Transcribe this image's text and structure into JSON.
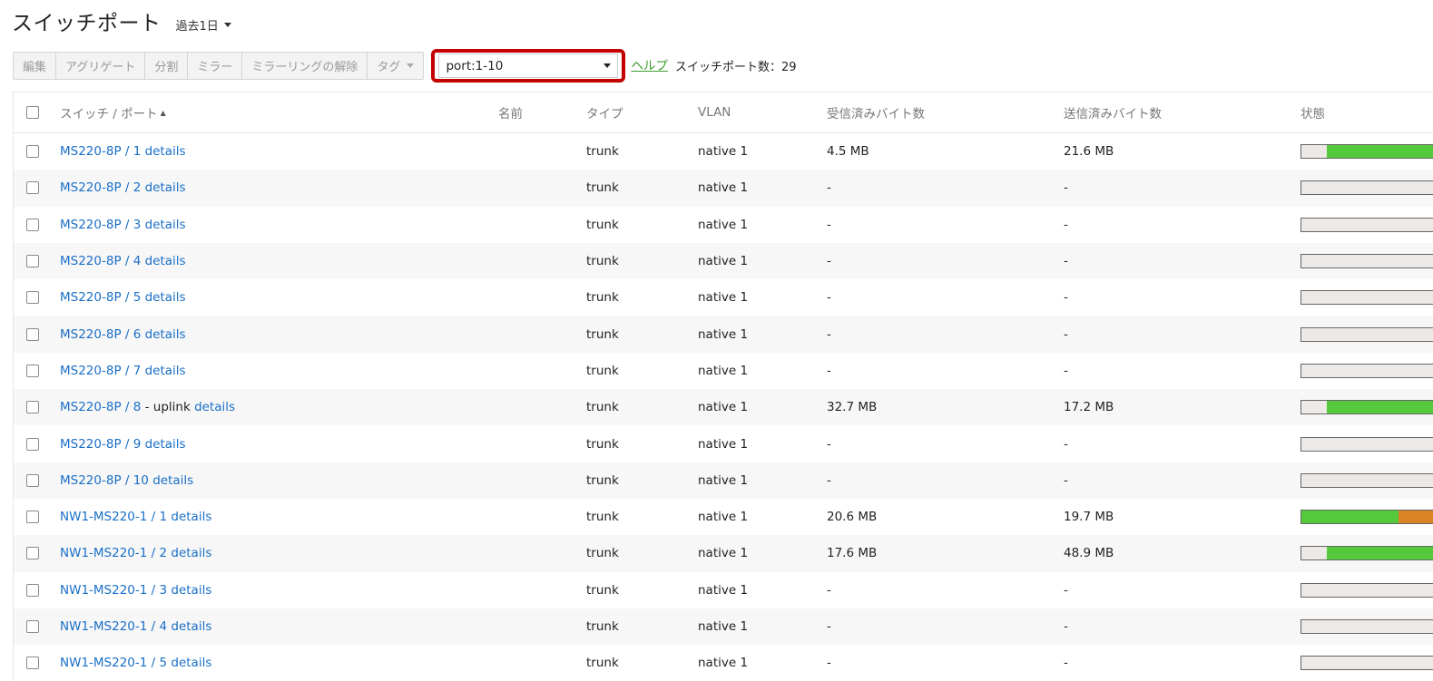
{
  "header": {
    "title": "スイッチポート",
    "timespan": "過去1日"
  },
  "toolbar": {
    "buttons": [
      "編集",
      "アグリゲート",
      "分割",
      "ミラー",
      "ミラーリングの解除",
      "タグ"
    ],
    "search_value": "port:1-10",
    "help_label": "ヘルプ",
    "count_text": "スイッチポート数：29"
  },
  "table": {
    "columns": [
      "スイッチ / ポート",
      "名前",
      "タイプ",
      "VLAN",
      "受信済みバイト数",
      "送信済みバイト数",
      "状態"
    ],
    "rows": [
      {
        "port": "MS220-8P / 1",
        "suffix": "",
        "details": "details",
        "type": "trunk",
        "vlan": "native 1",
        "rx": "4.5 MB",
        "tx": "21.6 MB"
      },
      {
        "port": "MS220-8P / 2",
        "suffix": "",
        "details": "details",
        "type": "trunk",
        "vlan": "native 1",
        "rx": "-",
        "tx": "-"
      },
      {
        "port": "MS220-8P / 3",
        "suffix": "",
        "details": "details",
        "type": "trunk",
        "vlan": "native 1",
        "rx": "-",
        "tx": "-"
      },
      {
        "port": "MS220-8P / 4",
        "suffix": "",
        "details": "details",
        "type": "trunk",
        "vlan": "native 1",
        "rx": "-",
        "tx": "-"
      },
      {
        "port": "MS220-8P / 5",
        "suffix": "",
        "details": "details",
        "type": "trunk",
        "vlan": "native 1",
        "rx": "-",
        "tx": "-"
      },
      {
        "port": "MS220-8P / 6",
        "suffix": "",
        "details": "details",
        "type": "trunk",
        "vlan": "native 1",
        "rx": "-",
        "tx": "-"
      },
      {
        "port": "MS220-8P / 7",
        "suffix": "",
        "details": "details",
        "type": "trunk",
        "vlan": "native 1",
        "rx": "-",
        "tx": "-"
      },
      {
        "port": "MS220-8P / 8",
        "suffix": " - uplink ",
        "details": "details",
        "type": "trunk",
        "vlan": "native 1",
        "rx": "32.7 MB",
        "tx": "17.2 MB"
      },
      {
        "port": "MS220-8P / 9",
        "suffix": "",
        "details": "details",
        "type": "trunk",
        "vlan": "native 1",
        "rx": "-",
        "tx": "-"
      },
      {
        "port": "MS220-8P / 10",
        "suffix": "",
        "details": "details",
        "type": "trunk",
        "vlan": "native 1",
        "rx": "-",
        "tx": "-"
      },
      {
        "port": "NW1-MS220-1 / 1",
        "suffix": "",
        "details": "details",
        "type": "trunk",
        "vlan": "native 1",
        "rx": "20.6 MB",
        "tx": "19.7 MB"
      },
      {
        "port": "NW1-MS220-1 / 2",
        "suffix": "",
        "details": "details",
        "type": "trunk",
        "vlan": "native 1",
        "rx": "17.6 MB",
        "tx": "48.9 MB"
      },
      {
        "port": "NW1-MS220-1 / 3",
        "suffix": "",
        "details": "details",
        "type": "trunk",
        "vlan": "native 1",
        "rx": "-",
        "tx": "-"
      },
      {
        "port": "NW1-MS220-1 / 4",
        "suffix": "",
        "details": "details",
        "type": "trunk",
        "vlan": "native 1",
        "rx": "-",
        "tx": "-"
      },
      {
        "port": "NW1-MS220-1 / 5",
        "suffix": "",
        "details": "details",
        "type": "trunk",
        "vlan": "native 1",
        "rx": "-",
        "tx": "-"
      }
    ],
    "status_bars": [
      [
        {
          "fraction": 0.19,
          "color": "#ede9e6"
        },
        {
          "fraction": 0.81,
          "color": "#54c93c"
        }
      ],
      [],
      [],
      [],
      [],
      [],
      [],
      [
        {
          "fraction": 0.19,
          "color": "#ede9e6"
        },
        {
          "fraction": 0.81,
          "color": "#54c93c"
        }
      ],
      [],
      [],
      [
        {
          "fraction": 0.72,
          "color": "#54c93c"
        },
        {
          "fraction": 0.28,
          "color": "#d98425"
        }
      ],
      [
        {
          "fraction": 0.19,
          "color": "#ede9e6"
        },
        {
          "fraction": 0.81,
          "color": "#54c93c"
        }
      ],
      [],
      [],
      []
    ]
  },
  "colors": {
    "link": "#1a6fc7",
    "help_link": "#3e9b2f",
    "highlight_border": "#c40000",
    "status_green": "#54c93c",
    "status_orange": "#d98425"
  }
}
